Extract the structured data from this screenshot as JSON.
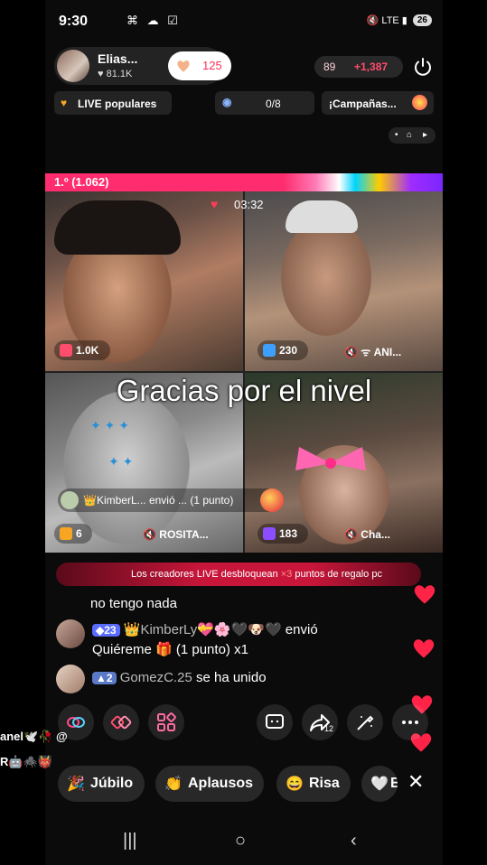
{
  "status_bar": {
    "time": "9:30",
    "left_icons": "⌘ ☁ ☑",
    "right_icons": "🔇 LTE ▮",
    "battery": "26"
  },
  "host": {
    "name": "Elias...",
    "likes": "81.1K",
    "follow_count": "125"
  },
  "gifts_pill": {
    "left": "89",
    "right": "+1,387"
  },
  "chips": {
    "popular": "LIVE populares",
    "match": "0/8",
    "campaigns": "¡Campañas..."
  },
  "rank": {
    "label": "1.º (1.062)"
  },
  "timer": "03:32",
  "grid": {
    "cells": [
      {
        "score": "1.0K",
        "mute_label": ""
      },
      {
        "score": "230",
        "mute_label": "🔇 ᯤ ANI..."
      },
      {
        "score": "6",
        "mute_label": "🔇 ROSITA..."
      },
      {
        "score": "183",
        "mute_label": "🔇 Cha..."
      }
    ]
  },
  "overlay_caption": "Gracias por el nivel",
  "gift_toast": "👑KimberL... envió ... (1 punto)",
  "promo": {
    "prefix": "Los creadores LIVE desbloquean ",
    "highlight": "×3",
    "suffix": " puntos de regalo pc"
  },
  "chat": [
    {
      "text": "no tengo nada"
    },
    {
      "level": "23",
      "user": "👑KimberLy💝🌸🖤🐶🖤",
      "action": "envió",
      "line2": "Quiéreme 🎁 (1 punto) x1"
    },
    {
      "level": "2",
      "user": "GomezC.25",
      "action": "se ha unido"
    }
  ],
  "reactions": [
    {
      "emoji": "🎉",
      "label": "Júbilo"
    },
    {
      "emoji": "👏",
      "label": "Aplausos"
    },
    {
      "emoji": "😄",
      "label": "Risa"
    },
    {
      "emoji": "🤍",
      "label": "E"
    }
  ],
  "share_count": "12",
  "sticker_text": {
    "line1": "anel🕊️🥀 @",
    "line2": "R🤖🕷️👹"
  },
  "colors": {
    "accent": "#ff2d55",
    "heart": "#ff2347",
    "promo": "#c8163a"
  }
}
